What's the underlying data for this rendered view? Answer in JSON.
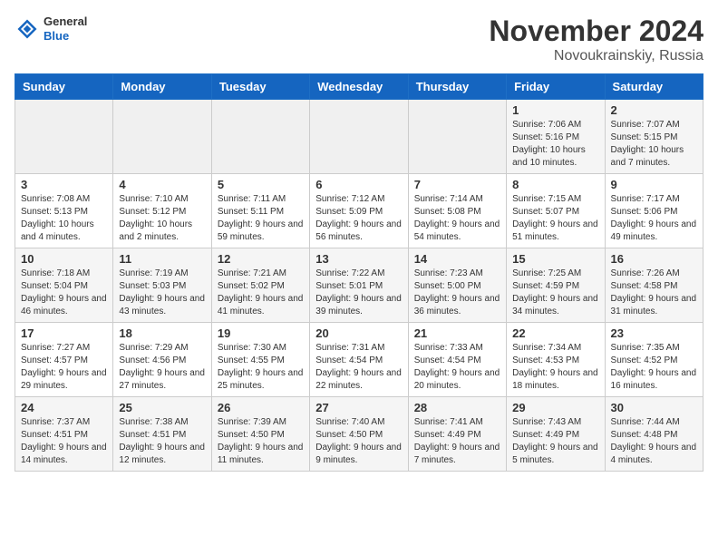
{
  "header": {
    "logo_general": "General",
    "logo_blue": "Blue",
    "title": "November 2024",
    "subtitle": "Novoukrainskiy, Russia"
  },
  "days_of_week": [
    "Sunday",
    "Monday",
    "Tuesday",
    "Wednesday",
    "Thursday",
    "Friday",
    "Saturday"
  ],
  "weeks": [
    [
      {
        "day": "",
        "info": ""
      },
      {
        "day": "",
        "info": ""
      },
      {
        "day": "",
        "info": ""
      },
      {
        "day": "",
        "info": ""
      },
      {
        "day": "",
        "info": ""
      },
      {
        "day": "1",
        "info": "Sunrise: 7:06 AM\nSunset: 5:16 PM\nDaylight: 10 hours and 10 minutes."
      },
      {
        "day": "2",
        "info": "Sunrise: 7:07 AM\nSunset: 5:15 PM\nDaylight: 10 hours and 7 minutes."
      }
    ],
    [
      {
        "day": "3",
        "info": "Sunrise: 7:08 AM\nSunset: 5:13 PM\nDaylight: 10 hours and 4 minutes."
      },
      {
        "day": "4",
        "info": "Sunrise: 7:10 AM\nSunset: 5:12 PM\nDaylight: 10 hours and 2 minutes."
      },
      {
        "day": "5",
        "info": "Sunrise: 7:11 AM\nSunset: 5:11 PM\nDaylight: 9 hours and 59 minutes."
      },
      {
        "day": "6",
        "info": "Sunrise: 7:12 AM\nSunset: 5:09 PM\nDaylight: 9 hours and 56 minutes."
      },
      {
        "day": "7",
        "info": "Sunrise: 7:14 AM\nSunset: 5:08 PM\nDaylight: 9 hours and 54 minutes."
      },
      {
        "day": "8",
        "info": "Sunrise: 7:15 AM\nSunset: 5:07 PM\nDaylight: 9 hours and 51 minutes."
      },
      {
        "day": "9",
        "info": "Sunrise: 7:17 AM\nSunset: 5:06 PM\nDaylight: 9 hours and 49 minutes."
      }
    ],
    [
      {
        "day": "10",
        "info": "Sunrise: 7:18 AM\nSunset: 5:04 PM\nDaylight: 9 hours and 46 minutes."
      },
      {
        "day": "11",
        "info": "Sunrise: 7:19 AM\nSunset: 5:03 PM\nDaylight: 9 hours and 43 minutes."
      },
      {
        "day": "12",
        "info": "Sunrise: 7:21 AM\nSunset: 5:02 PM\nDaylight: 9 hours and 41 minutes."
      },
      {
        "day": "13",
        "info": "Sunrise: 7:22 AM\nSunset: 5:01 PM\nDaylight: 9 hours and 39 minutes."
      },
      {
        "day": "14",
        "info": "Sunrise: 7:23 AM\nSunset: 5:00 PM\nDaylight: 9 hours and 36 minutes."
      },
      {
        "day": "15",
        "info": "Sunrise: 7:25 AM\nSunset: 4:59 PM\nDaylight: 9 hours and 34 minutes."
      },
      {
        "day": "16",
        "info": "Sunrise: 7:26 AM\nSunset: 4:58 PM\nDaylight: 9 hours and 31 minutes."
      }
    ],
    [
      {
        "day": "17",
        "info": "Sunrise: 7:27 AM\nSunset: 4:57 PM\nDaylight: 9 hours and 29 minutes."
      },
      {
        "day": "18",
        "info": "Sunrise: 7:29 AM\nSunset: 4:56 PM\nDaylight: 9 hours and 27 minutes."
      },
      {
        "day": "19",
        "info": "Sunrise: 7:30 AM\nSunset: 4:55 PM\nDaylight: 9 hours and 25 minutes."
      },
      {
        "day": "20",
        "info": "Sunrise: 7:31 AM\nSunset: 4:54 PM\nDaylight: 9 hours and 22 minutes."
      },
      {
        "day": "21",
        "info": "Sunrise: 7:33 AM\nSunset: 4:54 PM\nDaylight: 9 hours and 20 minutes."
      },
      {
        "day": "22",
        "info": "Sunrise: 7:34 AM\nSunset: 4:53 PM\nDaylight: 9 hours and 18 minutes."
      },
      {
        "day": "23",
        "info": "Sunrise: 7:35 AM\nSunset: 4:52 PM\nDaylight: 9 hours and 16 minutes."
      }
    ],
    [
      {
        "day": "24",
        "info": "Sunrise: 7:37 AM\nSunset: 4:51 PM\nDaylight: 9 hours and 14 minutes."
      },
      {
        "day": "25",
        "info": "Sunrise: 7:38 AM\nSunset: 4:51 PM\nDaylight: 9 hours and 12 minutes."
      },
      {
        "day": "26",
        "info": "Sunrise: 7:39 AM\nSunset: 4:50 PM\nDaylight: 9 hours and 11 minutes."
      },
      {
        "day": "27",
        "info": "Sunrise: 7:40 AM\nSunset: 4:50 PM\nDaylight: 9 hours and 9 minutes."
      },
      {
        "day": "28",
        "info": "Sunrise: 7:41 AM\nSunset: 4:49 PM\nDaylight: 9 hours and 7 minutes."
      },
      {
        "day": "29",
        "info": "Sunrise: 7:43 AM\nSunset: 4:49 PM\nDaylight: 9 hours and 5 minutes."
      },
      {
        "day": "30",
        "info": "Sunrise: 7:44 AM\nSunset: 4:48 PM\nDaylight: 9 hours and 4 minutes."
      }
    ]
  ]
}
